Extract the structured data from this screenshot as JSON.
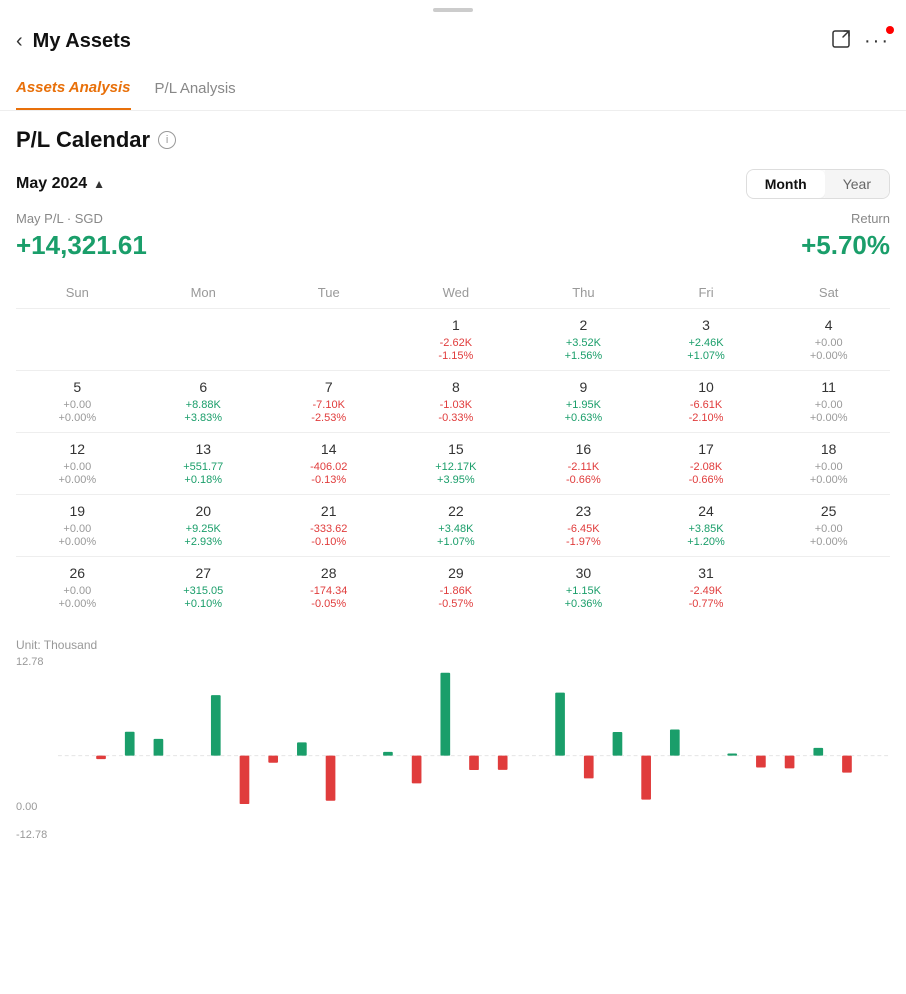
{
  "app": {
    "handle": "",
    "header": {
      "back_label": "‹",
      "title": "My Assets",
      "export_icon": "⬜",
      "more_icon": "•••"
    },
    "tabs": [
      {
        "id": "assets",
        "label": "Assets Analysis",
        "active": true
      },
      {
        "id": "pl",
        "label": "P/L Analysis",
        "active": false
      }
    ]
  },
  "pl_calendar": {
    "title": "P/L Calendar",
    "info_icon": "i",
    "date": "May 2024",
    "period_buttons": [
      "Month",
      "Year"
    ],
    "active_period": "Month",
    "summary": {
      "label": "May P/L · SGD",
      "value": "+14,321.61",
      "return_label": "Return",
      "return_value": "+5.70%"
    },
    "weekdays": [
      "Sun",
      "Mon",
      "Tue",
      "Wed",
      "Thu",
      "Fri",
      "Sat"
    ],
    "weeks": [
      [
        {
          "day": "",
          "val": "",
          "pct": "",
          "color": "neutral"
        },
        {
          "day": "",
          "val": "",
          "pct": "",
          "color": "neutral"
        },
        {
          "day": "",
          "val": "",
          "pct": "",
          "color": "neutral"
        },
        {
          "day": "1",
          "val": "-2.62K",
          "pct": "-1.15%",
          "color": "red"
        },
        {
          "day": "2",
          "val": "+3.52K",
          "pct": "+1.56%",
          "color": "green"
        },
        {
          "day": "3",
          "val": "+2.46K",
          "pct": "+1.07%",
          "color": "green"
        },
        {
          "day": "4",
          "val": "+0.00",
          "pct": "+0.00%",
          "color": "neutral"
        }
      ],
      [
        {
          "day": "5",
          "val": "+0.00",
          "pct": "+0.00%",
          "color": "neutral"
        },
        {
          "day": "6",
          "val": "+8.88K",
          "pct": "+3.83%",
          "color": "green"
        },
        {
          "day": "7",
          "val": "-7.10K",
          "pct": "-2.53%",
          "color": "red"
        },
        {
          "day": "8",
          "val": "-1.03K",
          "pct": "-0.33%",
          "color": "red"
        },
        {
          "day": "9",
          "val": "+1.95K",
          "pct": "+0.63%",
          "color": "green"
        },
        {
          "day": "10",
          "val": "-6.61K",
          "pct": "-2.10%",
          "color": "red"
        },
        {
          "day": "11",
          "val": "+0.00",
          "pct": "+0.00%",
          "color": "neutral"
        }
      ],
      [
        {
          "day": "12",
          "val": "+0.00",
          "pct": "+0.00%",
          "color": "neutral"
        },
        {
          "day": "13",
          "val": "+551.77",
          "pct": "+0.18%",
          "color": "green"
        },
        {
          "day": "14",
          "val": "-406.02",
          "pct": "-0.13%",
          "color": "red"
        },
        {
          "day": "15",
          "val": "+12.17K",
          "pct": "+3.95%",
          "color": "green"
        },
        {
          "day": "16",
          "val": "-2.11K",
          "pct": "-0.66%",
          "color": "red"
        },
        {
          "day": "17",
          "val": "-2.08K",
          "pct": "-0.66%",
          "color": "red"
        },
        {
          "day": "18",
          "val": "+0.00",
          "pct": "+0.00%",
          "color": "neutral"
        }
      ],
      [
        {
          "day": "19",
          "val": "+0.00",
          "pct": "+0.00%",
          "color": "neutral"
        },
        {
          "day": "20",
          "val": "+9.25K",
          "pct": "+2.93%",
          "color": "green"
        },
        {
          "day": "21",
          "val": "-333.62",
          "pct": "-0.10%",
          "color": "red"
        },
        {
          "day": "22",
          "val": "+3.48K",
          "pct": "+1.07%",
          "color": "green"
        },
        {
          "day": "23",
          "val": "-6.45K",
          "pct": "-1.97%",
          "color": "red"
        },
        {
          "day": "24",
          "val": "+3.85K",
          "pct": "+1.20%",
          "color": "green"
        },
        {
          "day": "25",
          "val": "+0.00",
          "pct": "+0.00%",
          "color": "neutral"
        }
      ],
      [
        {
          "day": "26",
          "val": "+0.00",
          "pct": "+0.00%",
          "color": "neutral"
        },
        {
          "day": "27",
          "val": "+315.05",
          "pct": "+0.10%",
          "color": "green"
        },
        {
          "day": "28",
          "val": "-174.34",
          "pct": "-0.05%",
          "color": "red"
        },
        {
          "day": "29",
          "val": "-1.86K",
          "pct": "-0.57%",
          "color": "red"
        },
        {
          "day": "30",
          "val": "+1.15K",
          "pct": "+0.36%",
          "color": "green"
        },
        {
          "day": "31",
          "val": "-2.49K",
          "pct": "-0.77%",
          "color": "red"
        },
        {
          "day": "",
          "val": "",
          "pct": "",
          "color": "neutral"
        }
      ]
    ],
    "chart": {
      "unit_label": "Unit: Thousand",
      "y_top": "12.78",
      "y_mid": "0.00",
      "y_bot": "-12.78",
      "bars": [
        {
          "x": 3,
          "val": -0.5,
          "color": "red"
        },
        {
          "x": 5,
          "val": 3.52,
          "color": "green"
        },
        {
          "x": 7,
          "val": 2.46,
          "color": "green"
        },
        {
          "x": 11,
          "val": 8.88,
          "color": "green"
        },
        {
          "x": 13,
          "val": -7.1,
          "color": "red"
        },
        {
          "x": 15,
          "val": -1.03,
          "color": "red"
        },
        {
          "x": 17,
          "val": 1.95,
          "color": "green"
        },
        {
          "x": 19,
          "val": -6.61,
          "color": "red"
        },
        {
          "x": 23,
          "val": 0.55,
          "color": "green"
        },
        {
          "x": 25,
          "val": -4.06,
          "color": "red"
        },
        {
          "x": 27,
          "val": 12.17,
          "color": "green"
        },
        {
          "x": 29,
          "val": -2.11,
          "color": "red"
        },
        {
          "x": 31,
          "val": -2.08,
          "color": "red"
        },
        {
          "x": 35,
          "val": 9.25,
          "color": "green"
        },
        {
          "x": 37,
          "val": -3.34,
          "color": "red"
        },
        {
          "x": 39,
          "val": 3.48,
          "color": "green"
        },
        {
          "x": 41,
          "val": -6.45,
          "color": "red"
        },
        {
          "x": 43,
          "val": 3.85,
          "color": "green"
        },
        {
          "x": 47,
          "val": 0.32,
          "color": "green"
        },
        {
          "x": 49,
          "val": -1.74,
          "color": "red"
        },
        {
          "x": 51,
          "val": -1.86,
          "color": "red"
        },
        {
          "x": 53,
          "val": 1.15,
          "color": "green"
        },
        {
          "x": 55,
          "val": -2.49,
          "color": "red"
        }
      ]
    }
  }
}
